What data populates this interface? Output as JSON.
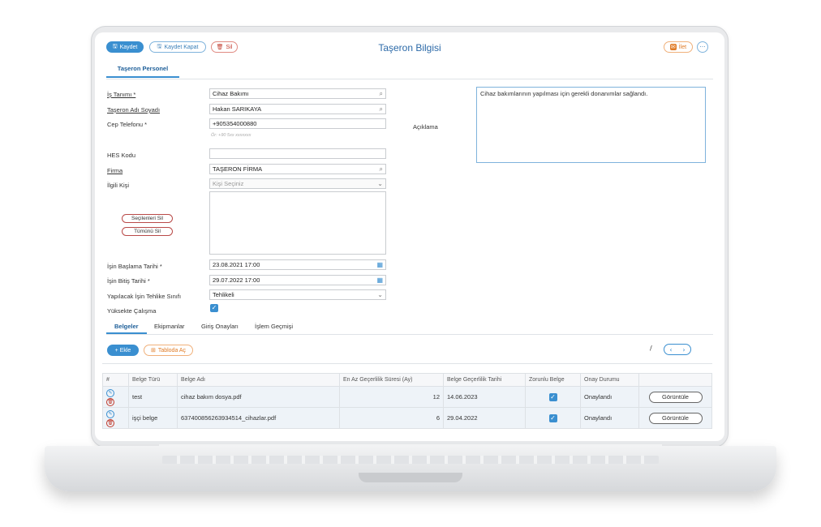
{
  "header": {
    "title": "Taşeron Bilgisi",
    "save_label": "Kaydet",
    "save_close_label": "Kaydet Kapat",
    "delete_label": "Sil",
    "send_label": "İlet",
    "more_label": "⋯"
  },
  "section_tab": "Taşeron Personel",
  "form": {
    "is_tanimi_label": "İş Tanımı *",
    "is_tanimi_value": "Cihaz Bakımı",
    "taseron_label": "Taşeron Adı Soyadı",
    "taseron_value": "Hakan SARIKAYA",
    "cep_label": "Cep Telefonu *",
    "cep_value": "+905354000880",
    "cep_hint": "Ör: +90 5xx xxxxxxx",
    "hes_label": "HES Kodu",
    "hes_value": "",
    "firma_label": "Firma",
    "firma_value": "TAŞERON FİRMA",
    "ilgili_label": "İlgili Kişi",
    "ilgili_placeholder": "Kişi Seçiniz",
    "secilenleri_sil": "Seçilenleri Sil",
    "tumunu_sil": "Tümünü Sil",
    "baslama_label": "İşin Başlama Tarihi *",
    "baslama_value": "23.08.2021 17:00",
    "bitis_label": "İşin Bitiş Tarihi *",
    "bitis_value": "29.07.2022 17:00",
    "tehlike_label": "Yapılacak İşin Tehlike Sınıfı",
    "tehlike_value": "Tehlikeli",
    "yuksekte_label": "Yüksekte Çalışma",
    "aciklama_label": "Açıklama",
    "aciklama_value": "Cihaz bakımlarının yapılması için gerekli donanımlar sağlandı."
  },
  "tabs": [
    "Belgeler",
    "Ekipmanlar",
    "Giriş Onayları",
    "İşlem Geçmişi"
  ],
  "toolbar": {
    "add_label": "+ Ekle",
    "table_open_label": "Tabloda Aç",
    "pager_sep": "/"
  },
  "table": {
    "headers": [
      "#",
      "Belge Türü",
      "Belge Adı",
      "En Az Geçerlilik Süresi (Ay)",
      "Belge Geçerlilik Tarihi",
      "Zorunlu Belge",
      "Onay Durumu",
      ""
    ],
    "rows": [
      {
        "tur": "test",
        "ad": "cihaz bakım dosya.pdf",
        "sure": "12",
        "tarih": "14.06.2023",
        "durum": "Onaylandı",
        "btn": "Görüntüle"
      },
      {
        "tur": "işçi belge",
        "ad": "637400856263934514_cihazlar.pdf",
        "sure": "6",
        "tarih": "29.04.2022",
        "durum": "Onaylandı",
        "btn": "Görüntüle"
      }
    ]
  },
  "colors": {
    "accent": "#3a8fd0",
    "danger": "#c0392b",
    "warning": "#e07b26"
  }
}
